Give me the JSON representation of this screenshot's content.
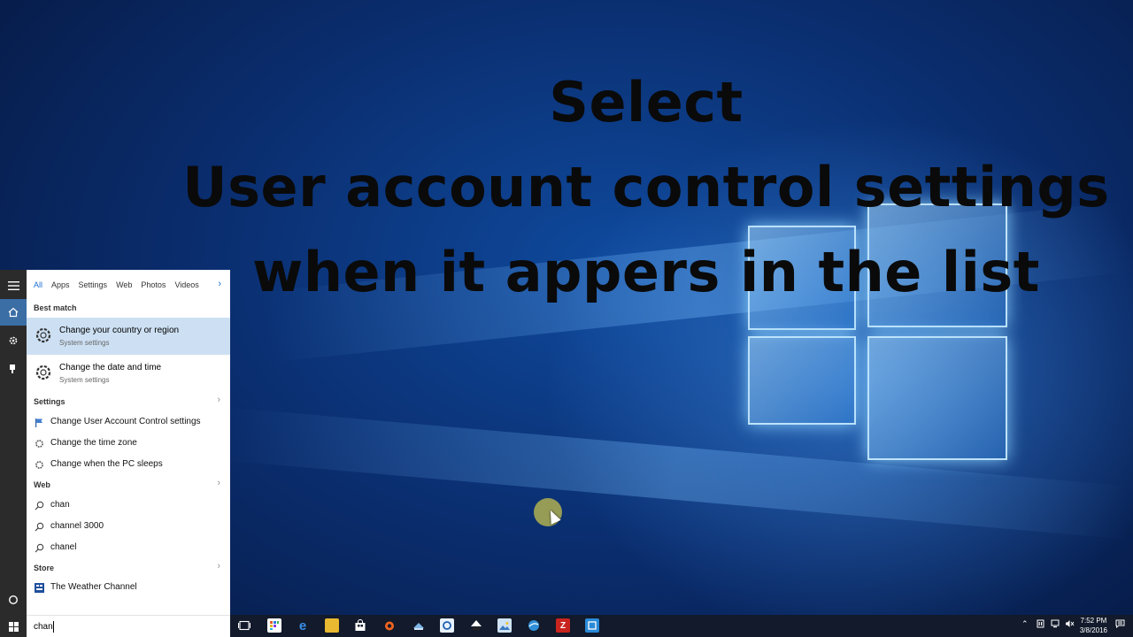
{
  "caption": {
    "line1": "Select",
    "line2": "User account control settings",
    "line3": "when it appers in the list"
  },
  "search_panel": {
    "tabs": [
      {
        "label": "All"
      },
      {
        "label": "Apps"
      },
      {
        "label": "Settings"
      },
      {
        "label": "Web"
      },
      {
        "label": "Photos"
      },
      {
        "label": "Videos"
      }
    ],
    "best_match_heading": "Best match",
    "best_match": [
      {
        "title": "Change your country or region",
        "subtitle": "System settings"
      },
      {
        "title": "Change the date and time",
        "subtitle": "System settings"
      }
    ],
    "settings_heading": "Settings",
    "settings_items": [
      {
        "label": "Change User Account Control settings",
        "icon": "flag-icon"
      },
      {
        "label": "Change the time zone",
        "icon": "gear-icon"
      },
      {
        "label": "Change when the PC sleeps",
        "icon": "gear-icon"
      }
    ],
    "web_heading": "Web",
    "web_items": [
      {
        "label": "chan"
      },
      {
        "label": "channel 3000"
      },
      {
        "label": "chanel"
      }
    ],
    "store_heading": "Store",
    "store_items": [
      {
        "label": "The Weather Channel"
      }
    ]
  },
  "search_box": {
    "value": "chan"
  },
  "taskbar": {
    "icons": [
      "task-view-icon",
      "app-grid-icon",
      "edge-icon",
      "file-explorer-icon",
      "store-icon",
      "origin-icon",
      "steam-icon",
      "uplay-icon",
      "inkscape-icon",
      "photos-icon",
      "browser-icon",
      "filezilla-icon",
      "capture-icon"
    ],
    "filezilla_letter": "Z",
    "edge_letter": "e"
  },
  "clock": {
    "time": "7:52 PM",
    "date": "3/8/2016"
  },
  "colors": {
    "accent": "#1e6fd2",
    "selected_row": "#cde0f3",
    "taskbar": "#121a2b",
    "rail": "#2b2b2b"
  }
}
